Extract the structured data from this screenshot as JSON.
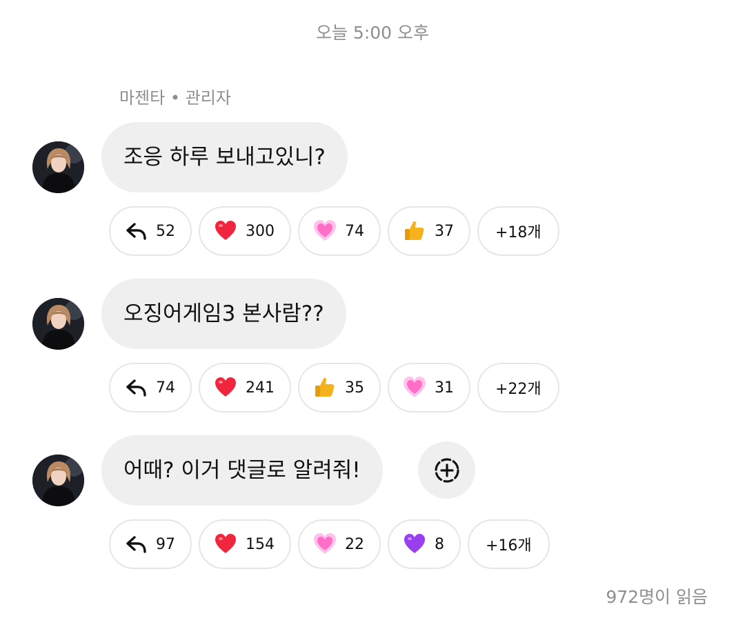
{
  "timestamp": "오늘 5:00 오후",
  "sender": "마젠타 • 관리자",
  "messages": [
    {
      "text": "조응 하루 보내고있니?",
      "reactions": [
        {
          "icon": "reply-arrow-icon",
          "count": "52"
        },
        {
          "icon": "red-heart-icon",
          "count": "300"
        },
        {
          "icon": "pink-growing-heart-icon",
          "count": "74"
        },
        {
          "icon": "thumbs-up-icon",
          "count": "37"
        }
      ],
      "more": "+18개"
    },
    {
      "text": "오징어게임3 본사람??",
      "reactions": [
        {
          "icon": "reply-arrow-icon",
          "count": "74"
        },
        {
          "icon": "red-heart-icon",
          "count": "241"
        },
        {
          "icon": "thumbs-up-icon",
          "count": "35"
        },
        {
          "icon": "pink-growing-heart-icon",
          "count": "31"
        }
      ],
      "more": "+22개"
    },
    {
      "text": "어때? 이거 댓글로 알려줘!",
      "reactions": [
        {
          "icon": "reply-arrow-icon",
          "count": "97"
        },
        {
          "icon": "red-heart-icon",
          "count": "154"
        },
        {
          "icon": "pink-growing-heart-icon",
          "count": "22"
        },
        {
          "icon": "purple-heart-icon",
          "count": "8"
        }
      ],
      "more": "+16개"
    }
  ],
  "read_status": "972명이 읽음",
  "colors": {
    "bubble": "#efefef",
    "muted_text": "#8e8e8e",
    "pill_border": "#e6e6e6",
    "red_heart": "#f0263f",
    "pink_heart": "#ff7fcf",
    "purple_heart": "#9a3ff0",
    "thumbs_up": "#f5b21c"
  }
}
